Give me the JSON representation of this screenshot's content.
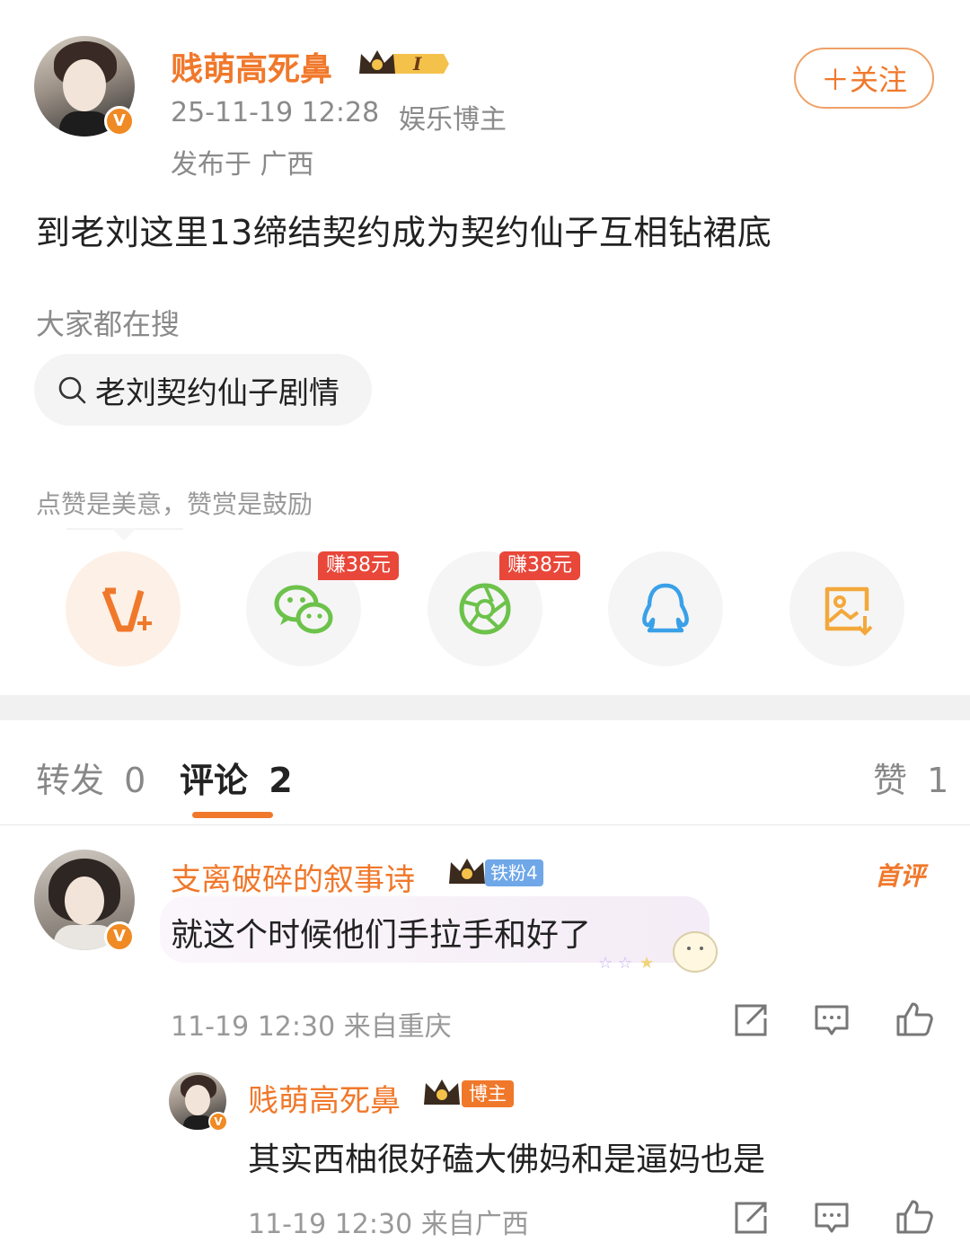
{
  "post": {
    "author": "贱萌高死鼻",
    "timestamp": "25-11-19 12:28",
    "author_tag": "娱乐博主",
    "location": "发布于 广西",
    "follow_label": "＋关注",
    "body": "到老刘这里13缔结契约成为契约仙子互相钻裙底"
  },
  "search": {
    "heading": "大家都在搜",
    "query": "老刘契约仙子剧情"
  },
  "share": {
    "hint": "点赞是美意，赞赏是鼓励",
    "badge1": "赚38元",
    "badge2": "赚38元"
  },
  "tabs": {
    "repost_label": "转发",
    "repost_count": "0",
    "comment_label": "评论",
    "comment_count": "2",
    "like_label": "赞",
    "like_count": "1"
  },
  "comments": [
    {
      "author": "支离破碎的叙事诗",
      "fan_badge": "铁粉4",
      "first_badge": "首评",
      "text": "就这个时候他们手拉手和好了",
      "meta": "11-19 12:30  来自重庆"
    }
  ],
  "reply": {
    "author": "贱萌高死鼻",
    "badge": "博主",
    "text": "其实西柚很好磕大佛妈和是逼妈也是",
    "meta": "11-19 12:30  来自广西"
  },
  "colors": {
    "accent": "#f0782b",
    "wechat_green": "#6cc24a",
    "qq_blue": "#3aa0e8",
    "album_orange": "#f3a83b",
    "badge_red": "#e8473a"
  },
  "icons": [
    "search-icon",
    "vplus-icon",
    "wechat-icon",
    "moments-icon",
    "qq-icon",
    "save-image-icon",
    "repost-icon",
    "comment-icon",
    "like-icon"
  ]
}
